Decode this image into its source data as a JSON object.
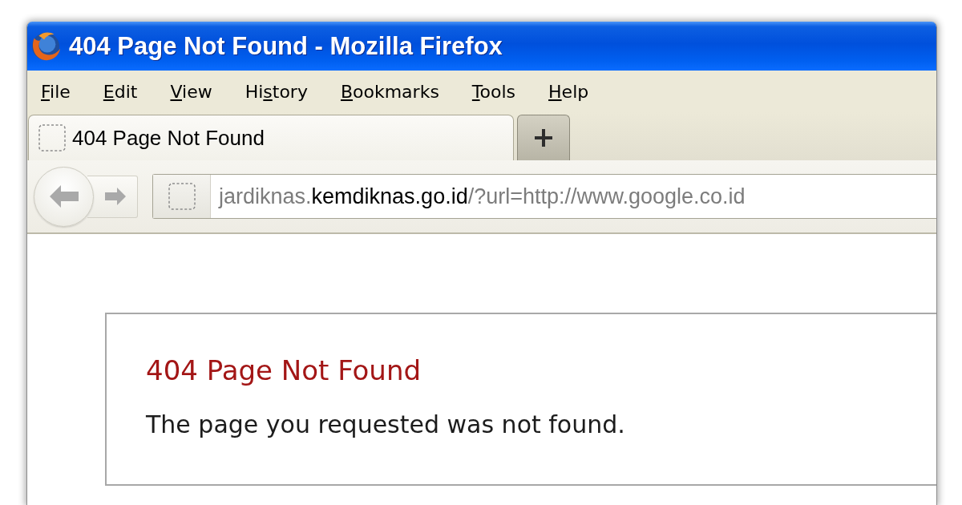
{
  "window": {
    "title": "404 Page Not Found - Mozilla Firefox"
  },
  "menu_bar": [
    {
      "key": "F",
      "rest": "ile"
    },
    {
      "key": "E",
      "rest": "dit"
    },
    {
      "key": "V",
      "rest": "iew"
    },
    {
      "lead": "Hi",
      "key": "s",
      "rest": "tory"
    },
    {
      "key": "B",
      "rest": "ookmarks"
    },
    {
      "key": "T",
      "rest": "ools"
    },
    {
      "key": "H",
      "rest": "elp"
    }
  ],
  "tabs": [
    {
      "label": "404 Page Not Found",
      "selected": true
    }
  ],
  "navigation": {
    "back": {
      "disabled": true
    },
    "forward": {
      "disabled": true
    }
  },
  "address_bar": {
    "prefix": "jardiknas.",
    "domain": "kemdiknas.go.id",
    "suffix": "/?url=http://www.google.co.id"
  },
  "page": {
    "heading": "404 Page Not Found",
    "message": "The page you requested was not found."
  }
}
